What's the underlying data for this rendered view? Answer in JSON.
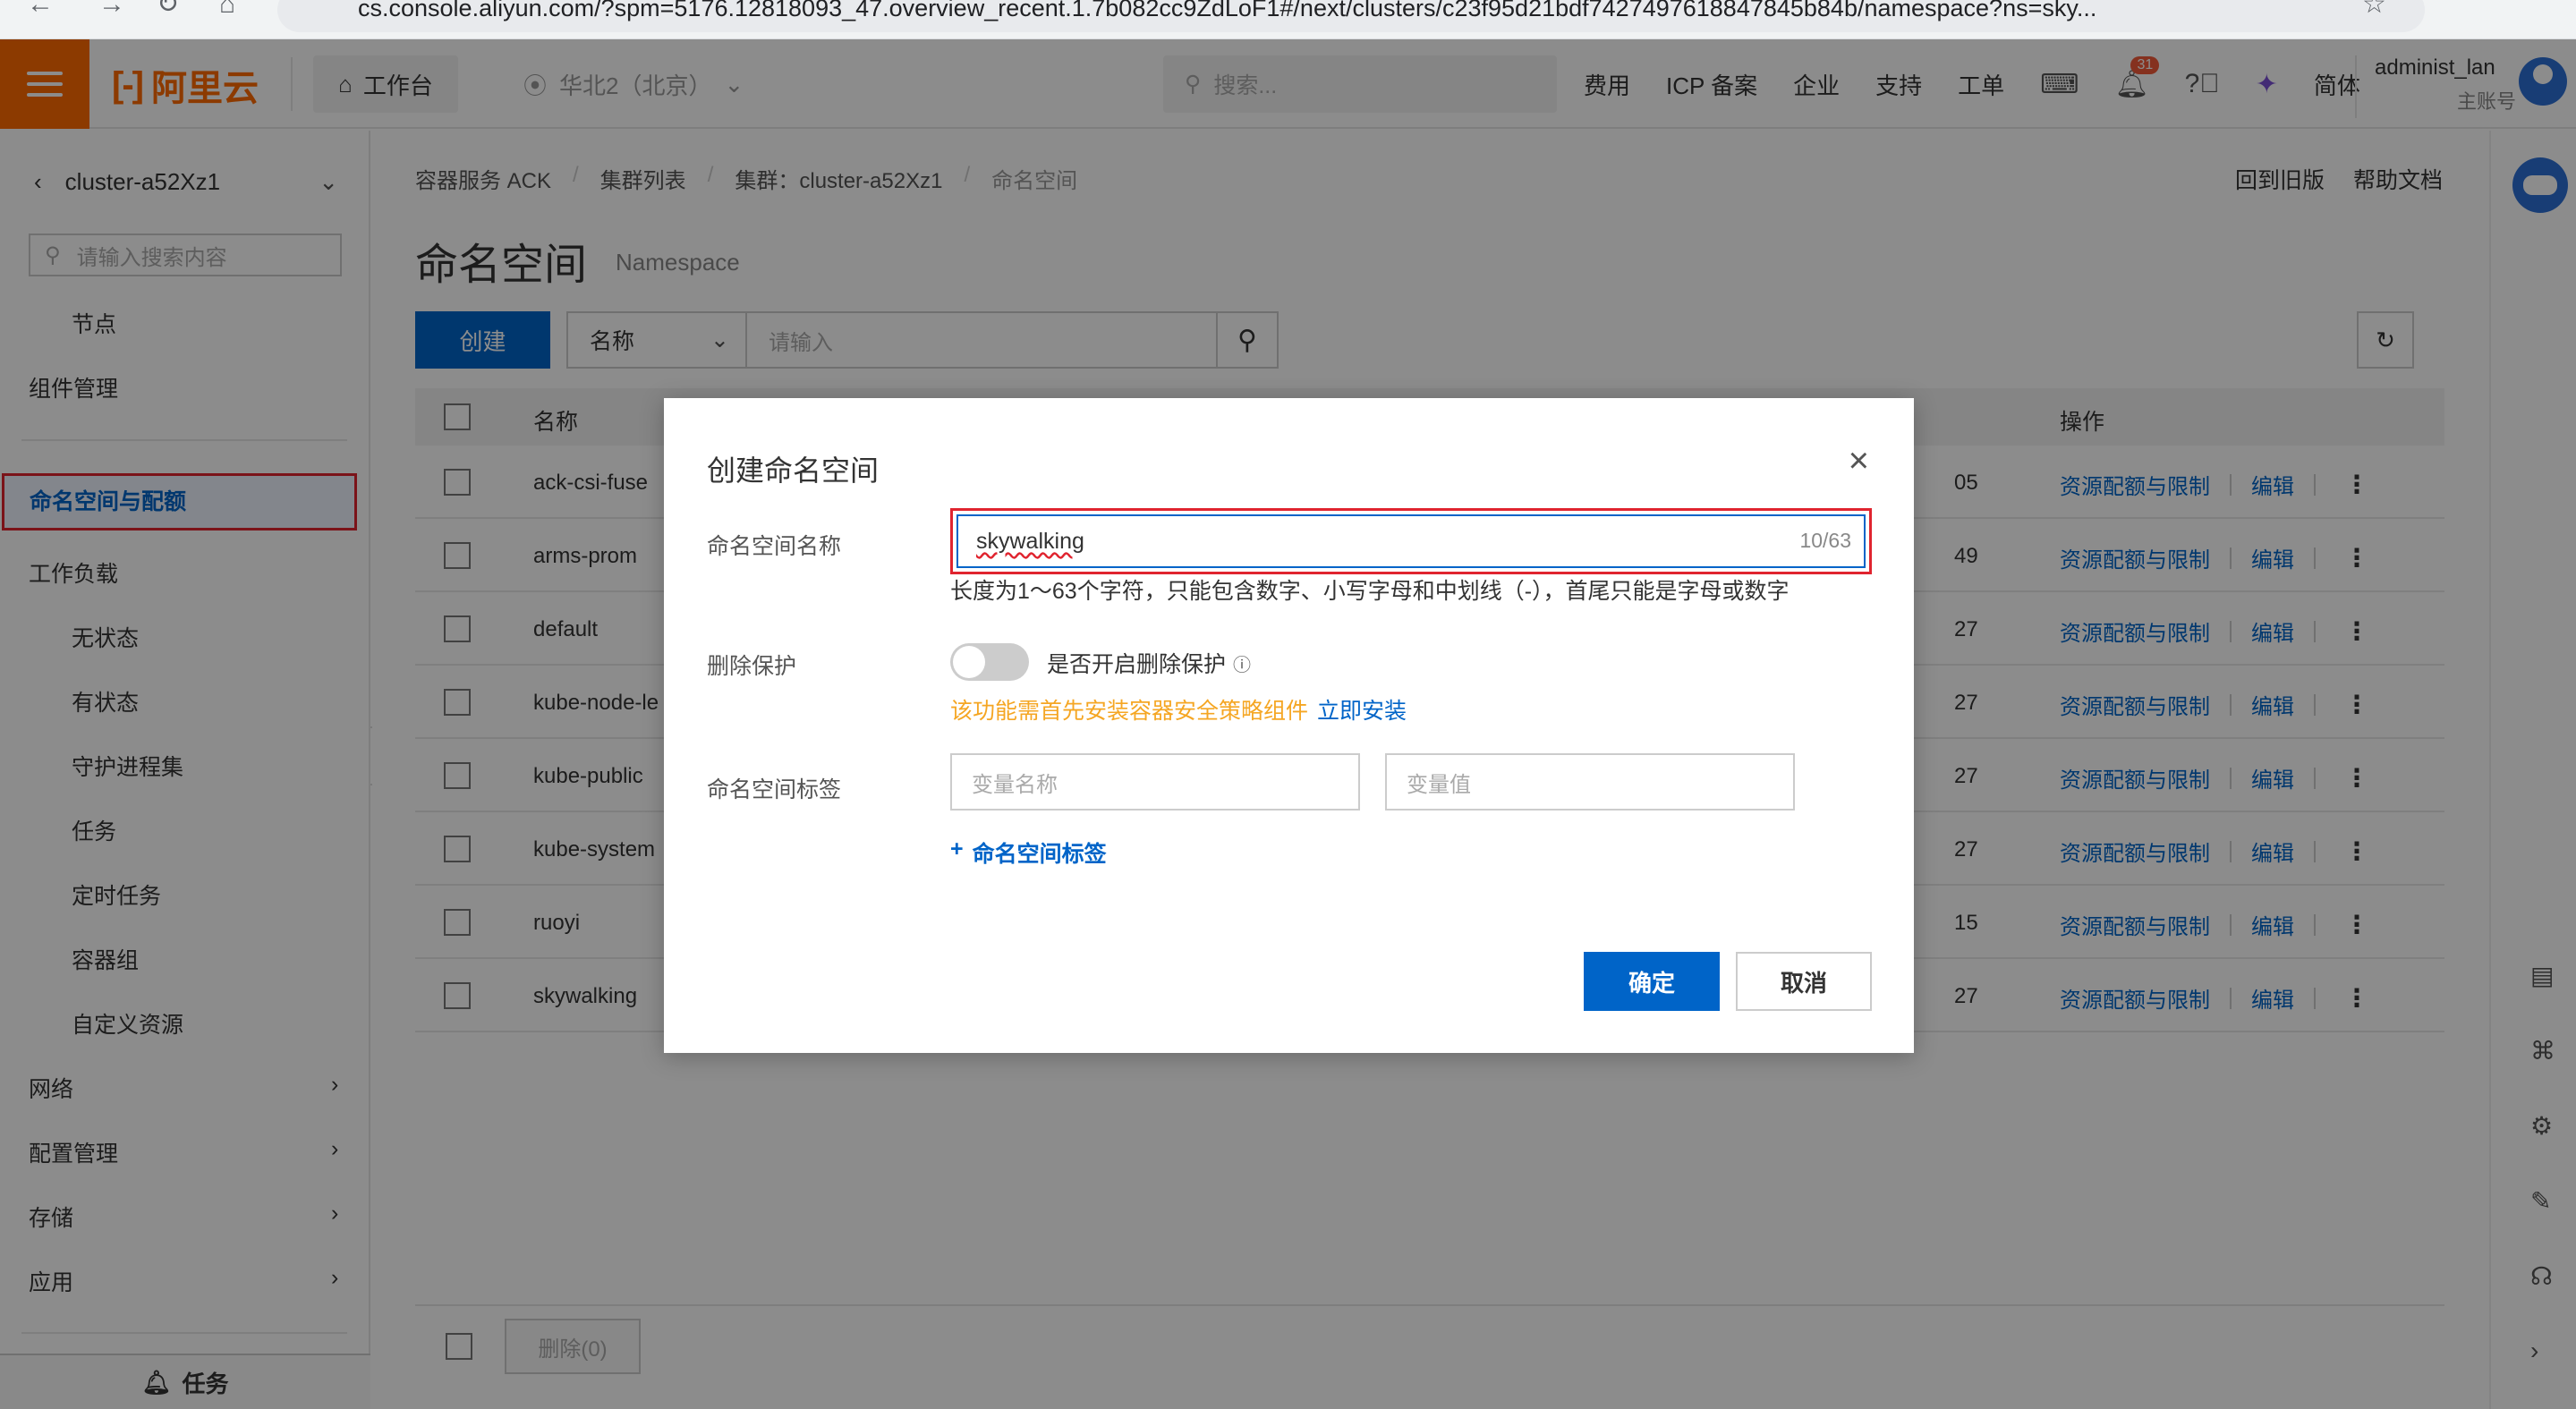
{
  "browser": {
    "url": "cs.console.aliyun.com/?spm=5176.12818093_47.overview_recent.1.7b082cc9ZdLoF1#/next/clusters/c23f95d21bdf7427497618847845b84b/namespace?ns=sky..."
  },
  "topbar": {
    "logo_text": "阿里云",
    "logo_mark": "[-]",
    "workbench": "工作台",
    "region": "华北2（北京）",
    "search_placeholder": "搜索...",
    "links": [
      "费用",
      "ICP 备案",
      "企业",
      "支持",
      "工单"
    ],
    "notification_count": "31",
    "lang": "简体",
    "user_name": "administ_lan",
    "user_sub": "主账号"
  },
  "sidebar": {
    "cluster_name": "cluster-a52Xz1",
    "search_placeholder": "请输入搜索内容",
    "items": {
      "node": "节点",
      "components": "组件管理",
      "namespace": "命名空间与配额",
      "workload": "工作负载",
      "stateless": "无状态",
      "stateful": "有状态",
      "daemonset": "守护进程集",
      "job": "任务",
      "cronjob": "定时任务",
      "pod": "容器组",
      "crd": "自定义资源",
      "network": "网络",
      "config": "配置管理",
      "storage": "存储",
      "apps": "应用"
    },
    "task_label": "任务"
  },
  "main": {
    "breadcrumb": [
      "容器服务 ACK",
      "集群列表",
      "集群：cluster-a52Xz1",
      "命名空间"
    ],
    "old_version": "回到旧版",
    "help_doc": "帮助文档",
    "title": "命名空间",
    "subtitle": "Namespace",
    "create_btn": "创建",
    "filter_field": "名称",
    "filter_placeholder": "请输入",
    "col_name": "名称",
    "col_ops": "操作",
    "rows": [
      {
        "name": "ack-csi-fuse",
        "time": "05"
      },
      {
        "name": "arms-prom",
        "time": "49"
      },
      {
        "name": "default",
        "time": "27"
      },
      {
        "name": "kube-node-le",
        "time": "27"
      },
      {
        "name": "kube-public",
        "time": "27"
      },
      {
        "name": "kube-system",
        "time": "27"
      },
      {
        "name": "ruoyi",
        "time": "15"
      },
      {
        "name": "skywalking",
        "time": "27"
      }
    ],
    "op_quota": "资源配额与限制",
    "op_edit": "编辑",
    "delete_btn": "删除(0)"
  },
  "modal": {
    "title": "创建命名空间",
    "name_label": "命名空间名称",
    "name_value": "skywalking",
    "name_count": "10/63",
    "name_hint": "长度为1～63个字符，只能包含数字、小写字母和中划线（-），首尾只能是字母或数字",
    "protect_label": "删除保护",
    "protect_toggle_label": "是否开启删除保护",
    "protect_warn": "该功能需首先安装容器安全策略组件",
    "protect_install": "立即安装",
    "tag_label": "命名空间标签",
    "tag_key_placeholder": "变量名称",
    "tag_value_placeholder": "变量值",
    "add_tag": "命名空间标签",
    "ok": "确定",
    "cancel": "取消"
  }
}
